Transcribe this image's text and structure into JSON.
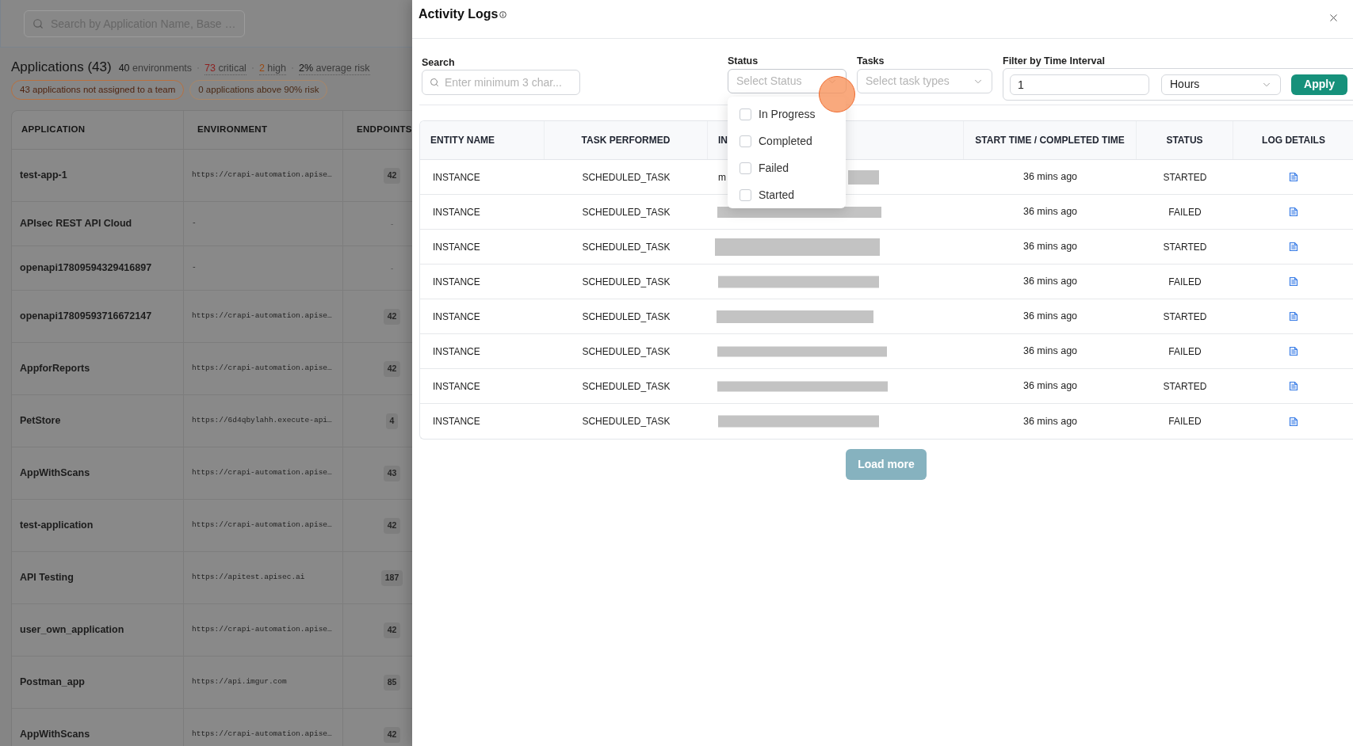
{
  "applications_page": {
    "search": {
      "placeholder": "Search by Application Name, Base …"
    },
    "title": "Applications (43)",
    "stats": [
      {
        "count": "40",
        "caption": "environments",
        "kind": "plain"
      },
      {
        "count": "73",
        "caption": "critical",
        "kind": "critical"
      },
      {
        "count": "2",
        "caption": "high",
        "kind": "high"
      },
      {
        "count": "2%",
        "caption": "average risk",
        "kind": "average"
      }
    ],
    "badges": [
      {
        "text": "43 applications not assigned to a team",
        "kind": "warning"
      },
      {
        "text": "0 applications above 90% risk",
        "kind": "neutral"
      }
    ],
    "table": {
      "columns": [
        "APPLICATION",
        "ENVIRONMENT",
        "ENDPOINTS"
      ],
      "rows": [
        {
          "application": "test-app-1",
          "environment": "https://crapi-automation.apise…",
          "endpoints": {
            "text": "42",
            "kind": "badge"
          }
        },
        {
          "application": "APIsec REST API Cloud",
          "environment": "-",
          "endpoints": {
            "text": "-",
            "kind": "plain"
          }
        },
        {
          "application": "openapi17809594329416897",
          "environment": "-",
          "endpoints": {
            "text": "-",
            "kind": "plain"
          }
        },
        {
          "application": "openapi17809593716672147",
          "environment": "https://crapi-automation.apise…",
          "endpoints": {
            "text": "42",
            "kind": "badge"
          }
        },
        {
          "application": "AppforReports",
          "environment": "https://crapi-automation.apise…",
          "endpoints": {
            "text": "42",
            "kind": "badge"
          }
        },
        {
          "application": "PetStore",
          "environment": "https://6d4qbylahh.execute-api…",
          "endpoints": {
            "text": "4",
            "kind": "badge"
          }
        },
        {
          "application": "AppWithScans",
          "environment": "https://crapi-automation.apise…",
          "endpoints": {
            "text": "43",
            "kind": "badge"
          }
        },
        {
          "application": "test-application",
          "environment": "https://crapi-automation.apise…",
          "endpoints": {
            "text": "42",
            "kind": "badge"
          }
        },
        {
          "application": "API Testing",
          "environment": "https://apitest.apisec.ai",
          "endpoints": {
            "text": "187",
            "kind": "badge"
          }
        },
        {
          "application": "user_own_application",
          "environment": "https://crapi-automation.apise…",
          "endpoints": {
            "text": "42",
            "kind": "badge"
          }
        },
        {
          "application": "Postman_app",
          "environment": "https://api.imgur.com",
          "endpoints": {
            "text": "85",
            "kind": "badge"
          }
        },
        {
          "application": "AppWithScans",
          "environment": "https://crapi-automation.apise…",
          "endpoints": {
            "text": "42",
            "kind": "badge"
          }
        }
      ]
    }
  },
  "activity_logs": {
    "title": "Activity Logs",
    "filters": {
      "search": {
        "label": "Search",
        "placeholder": "Enter minimum 3 char..."
      },
      "status": {
        "label": "Status",
        "placeholder": "Select Status",
        "expanded": true,
        "options": [
          {
            "label": "In Progress",
            "checked": false
          },
          {
            "label": "Completed",
            "checked": false
          },
          {
            "label": "Failed",
            "checked": false
          },
          {
            "label": "Started",
            "checked": false
          }
        ]
      },
      "tasks": {
        "label": "Tasks",
        "placeholder": "Select task types"
      },
      "time_interval": {
        "label": "Filter by Time Interval",
        "value": "1",
        "unit": "Hours",
        "apply_button": "Apply"
      }
    },
    "table": {
      "columns": [
        "ENTITY NAME",
        "TASK PERFORMED",
        "IN",
        "START TIME / COMPLETED TIME",
        "STATUS",
        "LOG DETAILS"
      ],
      "rows": [
        {
          "entity_name": "INSTANCE",
          "task_performed": "SCHEDULED_TASK",
          "column_3": {
            "text": "m",
            "redacted": true
          },
          "time": "36 mins ago",
          "status": "STARTED"
        },
        {
          "entity_name": "INSTANCE",
          "task_performed": "SCHEDULED_TASK",
          "column_3": {
            "redacted": true
          },
          "time": "36 mins ago",
          "status": "FAILED"
        },
        {
          "entity_name": "INSTANCE",
          "task_performed": "SCHEDULED_TASK",
          "column_3": {
            "redacted": true
          },
          "time": "36 mins ago",
          "status": "STARTED"
        },
        {
          "entity_name": "INSTANCE",
          "task_performed": "SCHEDULED_TASK",
          "column_3": {
            "redacted": true
          },
          "time": "36 mins ago",
          "status": "FAILED"
        },
        {
          "entity_name": "INSTANCE",
          "task_performed": "SCHEDULED_TASK",
          "column_3": {
            "redacted": true
          },
          "time": "36 mins ago",
          "status": "STARTED"
        },
        {
          "entity_name": "INSTANCE",
          "task_performed": "SCHEDULED_TASK",
          "column_3": {
            "redacted": true
          },
          "time": "36 mins ago",
          "status": "FAILED"
        },
        {
          "entity_name": "INSTANCE",
          "task_performed": "SCHEDULED_TASK",
          "column_3": {
            "redacted": true
          },
          "time": "36 mins ago",
          "status": "STARTED"
        },
        {
          "entity_name": "INSTANCE",
          "task_performed": "SCHEDULED_TASK",
          "column_3": {
            "redacted": true
          },
          "time": "36 mins ago",
          "status": "FAILED"
        }
      ]
    },
    "load_more_button": "Load more"
  }
}
